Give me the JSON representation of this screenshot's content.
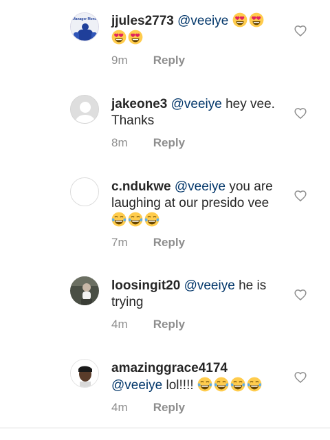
{
  "comments": [
    {
      "username": "jjules2773",
      "mention": "@veeiye",
      "text": "",
      "emojis": [
        "heart-eyes",
        "heart-eyes",
        "heart-eyes",
        "heart-eyes"
      ],
      "time": "9m",
      "reply_label": "Reply",
      "avatar_text": "Manager Month"
    },
    {
      "username": "jakeone3",
      "mention": "@veeiye",
      "text": "hey vee. Thanks",
      "emojis": [],
      "time": "8m",
      "reply_label": "Reply"
    },
    {
      "username": "c.ndukwe",
      "mention": "@veeiye",
      "text": "you are laughing at our presido vee",
      "emojis": [
        "tears-of-joy",
        "tears-of-joy",
        "tears-of-joy"
      ],
      "time": "7m",
      "reply_label": "Reply"
    },
    {
      "username": "loosingit20",
      "mention": "@veeiye",
      "text": "he is trying",
      "emojis": [],
      "time": "4m",
      "reply_label": "Reply"
    },
    {
      "username": "amazinggrace4174",
      "mention": "@veeiye",
      "text": "lol!!!!",
      "emojis": [
        "tears-of-joy",
        "tears-of-joy",
        "tears-of-joy",
        "tears-of-joy"
      ],
      "time": "4m",
      "reply_label": "Reply"
    }
  ],
  "colors": {
    "mention": "#003569",
    "meta": "#8e8e8e",
    "username": "#262626",
    "emoji_face": "#FFCC4D",
    "emoji_heart": "#E0245E",
    "emoji_tear": "#5DADEC"
  },
  "icons": {
    "like": "heart-outline-icon",
    "emoji_heart_eyes": "heart-eyes-emoji",
    "emoji_tears_of_joy": "tears-of-joy-emoji"
  }
}
